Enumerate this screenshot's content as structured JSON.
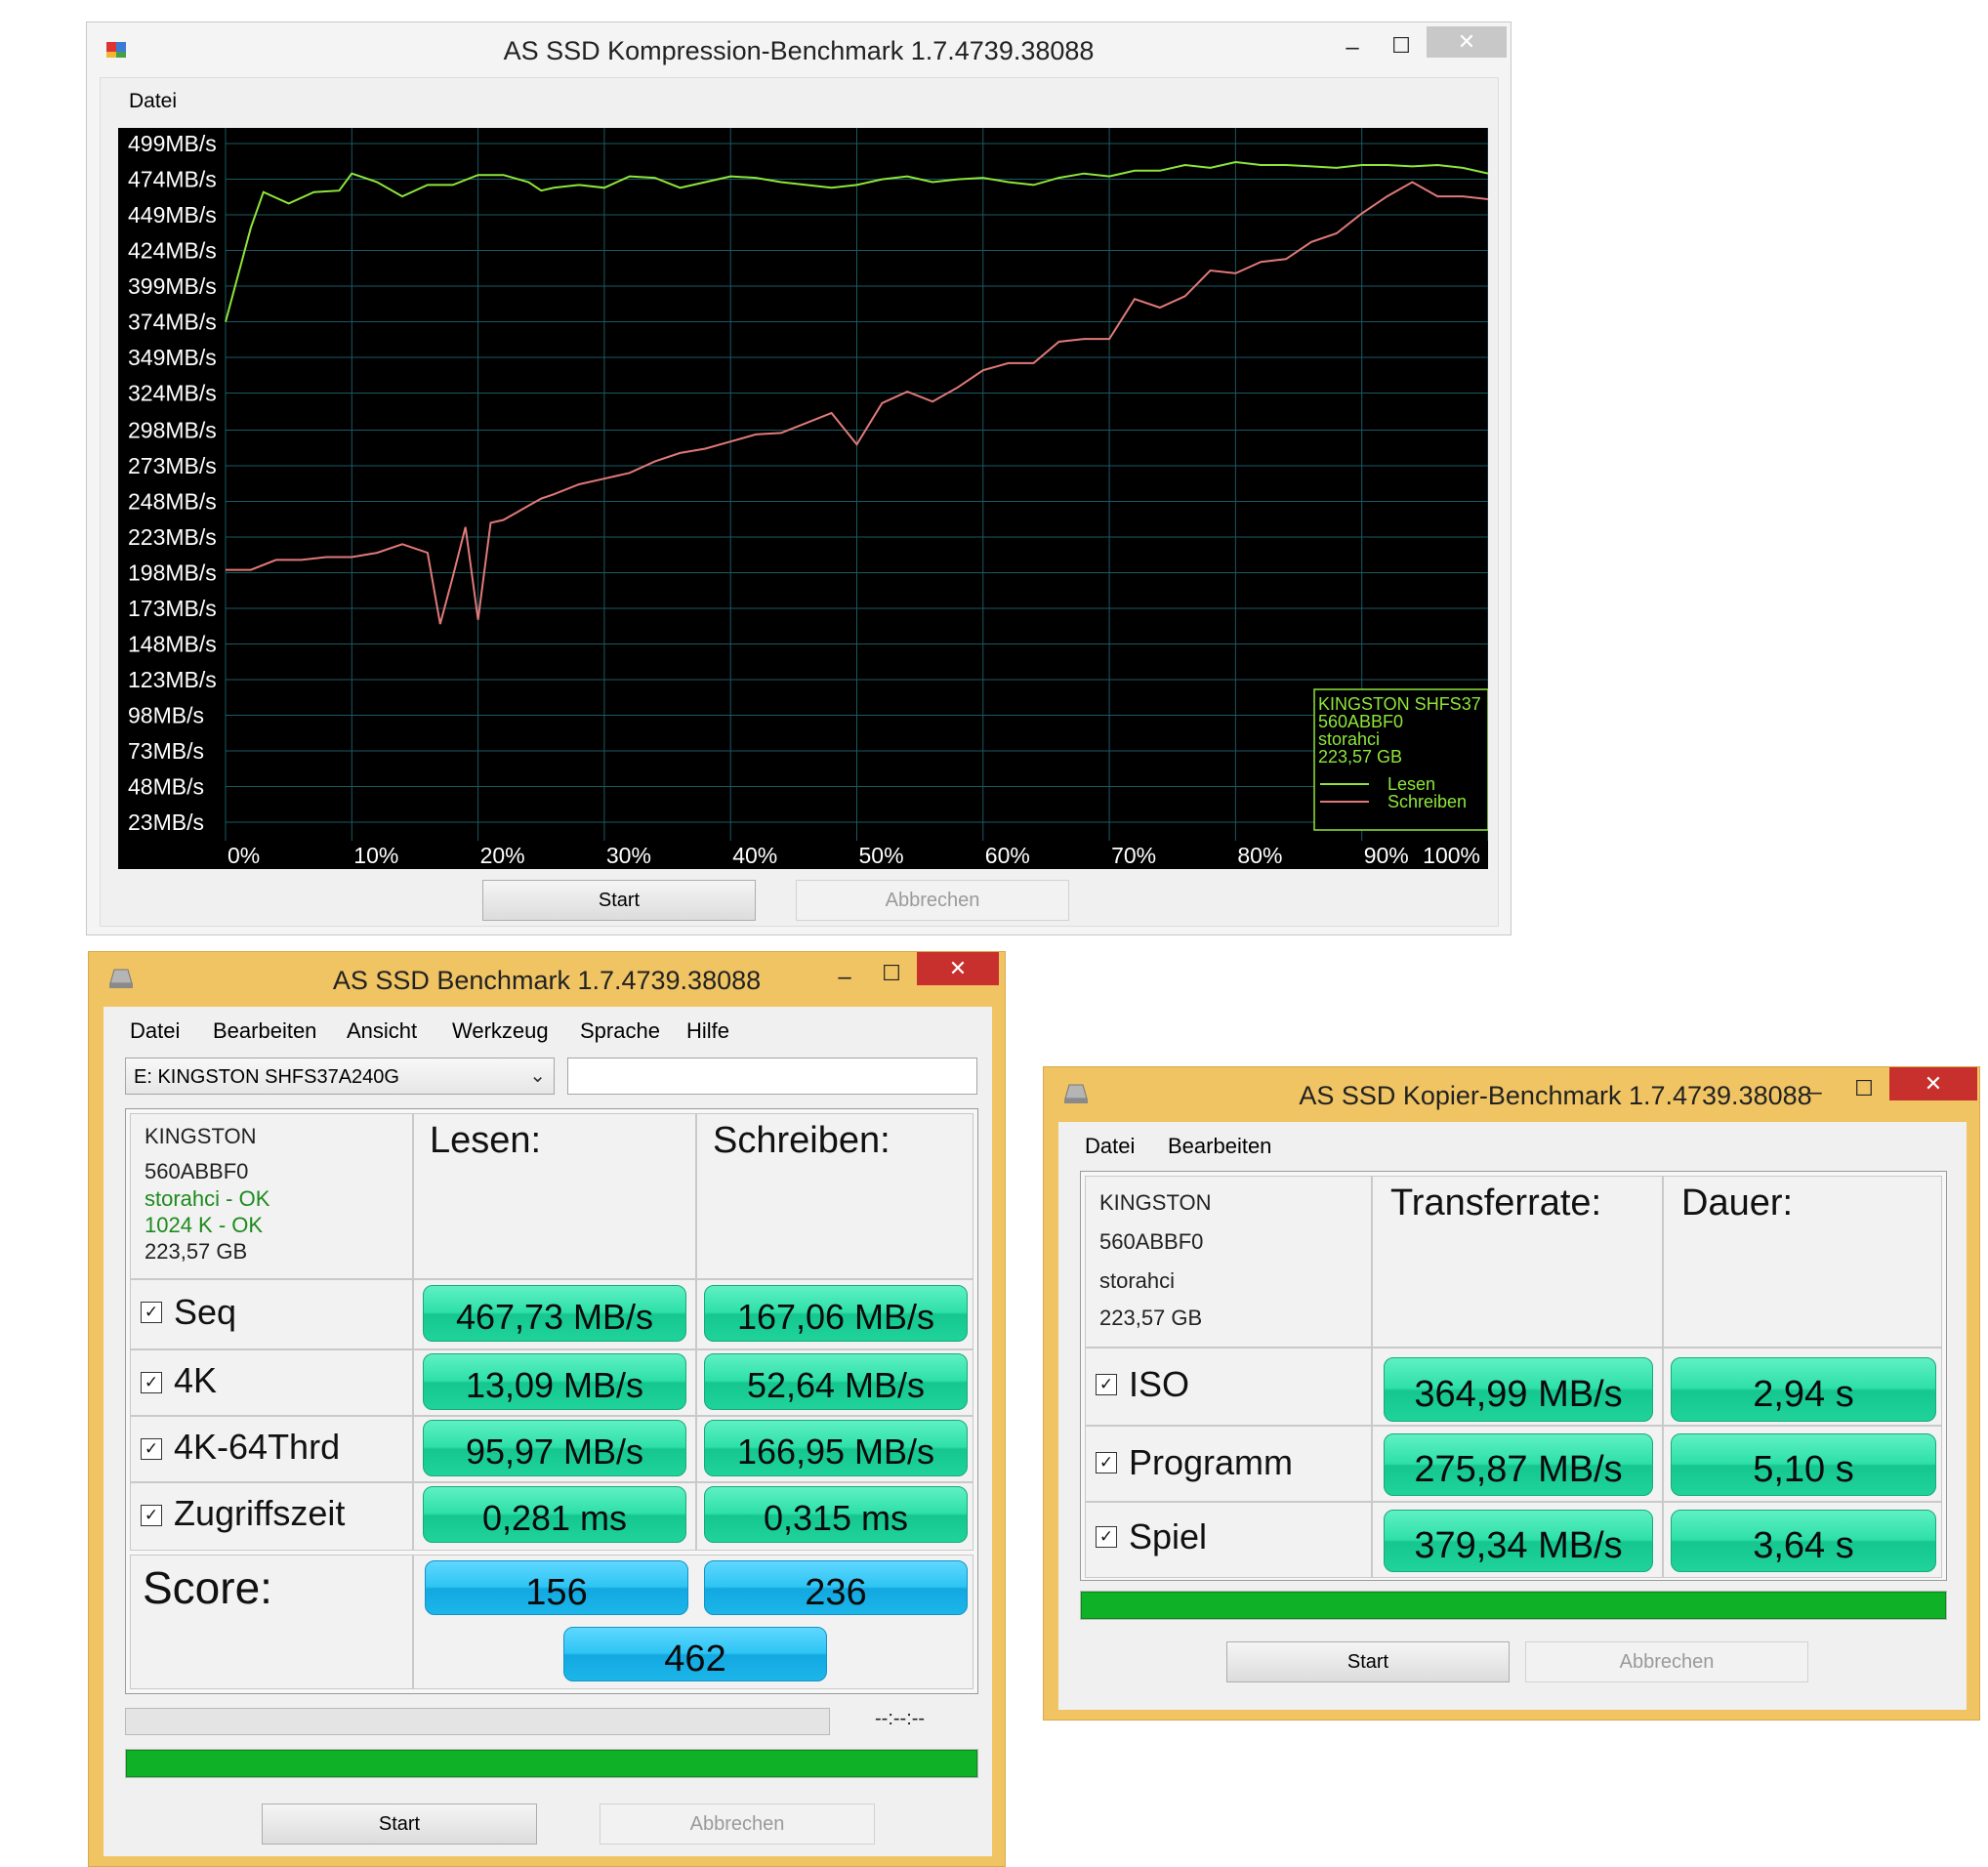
{
  "compression_window": {
    "title": "AS SSD Kompression-Benchmark 1.7.4739.38088",
    "minimize_glyph": "–",
    "maximize_glyph": "☐",
    "close_glyph": "✕",
    "menu": [
      "Datei"
    ],
    "start_label": "Start",
    "cancel_label": "Abbrechen",
    "legend": {
      "lines": [
        "KINGSTON SHFS37",
        "560ABBF0",
        "storahci",
        "223,57 GB"
      ],
      "read_label": "Lesen",
      "write_label": "Schreiben"
    },
    "colors": {
      "read": "#8ee63a",
      "write": "#e07a78",
      "grid": "#1a5a63",
      "text": "#ffffff",
      "background": "#000000"
    }
  },
  "chart_data": {
    "type": "line",
    "y_tick_labels": [
      "499MB/s",
      "474MB/s",
      "449MB/s",
      "424MB/s",
      "399MB/s",
      "374MB/s",
      "349MB/s",
      "324MB/s",
      "298MB/s",
      "273MB/s",
      "248MB/s",
      "223MB/s",
      "198MB/s",
      "173MB/s",
      "148MB/s",
      "123MB/s",
      "98MB/s",
      "73MB/s",
      "48MB/s",
      "23MB/s"
    ],
    "x_tick_labels": [
      "0%",
      "10%",
      "20%",
      "30%",
      "40%",
      "50%",
      "60%",
      "70%",
      "80%",
      "90%",
      "100%"
    ],
    "xlim": [
      0,
      100
    ],
    "ylim": [
      10,
      510
    ],
    "grid": true,
    "legend_position": "bottom-right",
    "series": [
      {
        "name": "Lesen",
        "x": [
          0,
          2,
          3,
          5,
          7,
          9,
          10,
          12,
          14,
          16,
          18,
          20,
          22,
          24,
          25,
          26,
          28,
          30,
          32,
          34,
          36,
          38,
          40,
          42,
          44,
          46,
          48,
          50,
          52,
          54,
          56,
          58,
          60,
          62,
          64,
          66,
          68,
          70,
          72,
          74,
          76,
          78,
          80,
          82,
          84,
          86,
          88,
          90,
          92,
          94,
          96,
          98,
          100
        ],
        "y": [
          374,
          440,
          465,
          457,
          465,
          466,
          478,
          472,
          462,
          470,
          470,
          477,
          477,
          472,
          466,
          468,
          470,
          468,
          476,
          475,
          468,
          472,
          476,
          475,
          472,
          470,
          468,
          470,
          474,
          476,
          472,
          474,
          475,
          472,
          470,
          475,
          478,
          476,
          480,
          480,
          484,
          482,
          486,
          484,
          484,
          483,
          482,
          484,
          484,
          483,
          484,
          482,
          478
        ]
      },
      {
        "name": "Schreiben",
        "x": [
          0,
          2,
          4,
          6,
          8,
          10,
          12,
          14,
          16,
          17,
          18,
          19,
          20,
          21,
          22,
          23,
          24,
          25,
          26,
          28,
          30,
          32,
          34,
          36,
          38,
          40,
          42,
          44,
          46,
          48,
          50,
          52,
          54,
          56,
          58,
          60,
          62,
          64,
          66,
          68,
          70,
          72,
          74,
          76,
          78,
          80,
          82,
          84,
          86,
          88,
          90,
          92,
          94,
          96,
          98,
          100
        ],
        "y": [
          200,
          200,
          207,
          207,
          209,
          209,
          212,
          218,
          212,
          162,
          195,
          230,
          165,
          233,
          235,
          240,
          245,
          250,
          253,
          260,
          264,
          268,
          276,
          282,
          285,
          290,
          295,
          296,
          303,
          310,
          288,
          317,
          325,
          318,
          328,
          340,
          345,
          345,
          360,
          362,
          362,
          390,
          384,
          392,
          410,
          408,
          416,
          418,
          430,
          436,
          450,
          462,
          472,
          462,
          462,
          460
        ]
      }
    ]
  },
  "benchmark_window": {
    "title": "AS SSD Benchmark 1.7.4739.38088",
    "minimize_glyph": "–",
    "maximize_glyph": "☐",
    "close_glyph": "✕",
    "menu": [
      "Datei",
      "Bearbeiten",
      "Ansicht",
      "Werkzeug",
      "Sprache",
      "Hilfe"
    ],
    "drive_select": "E: KINGSTON SHFS37A240G",
    "drive_info": [
      "KINGSTON",
      "560ABBF0",
      "storahci - OK",
      "1024 K - OK",
      "223,57 GB"
    ],
    "col_read": "Lesen:",
    "col_write": "Schreiben:",
    "check_glyph": "✓",
    "rows": [
      {
        "label": "Seq",
        "read": "467,73 MB/s",
        "write": "167,06 MB/s"
      },
      {
        "label": "4K",
        "read": "13,09 MB/s",
        "write": "52,64 MB/s"
      },
      {
        "label": "4K-64Thrd",
        "read": "95,97 MB/s",
        "write": "166,95 MB/s"
      },
      {
        "label": "Zugriffszeit",
        "read": "0,281 ms",
        "write": "0,315 ms"
      }
    ],
    "score_label": "Score:",
    "score_read": "156",
    "score_write": "236",
    "score_total": "462",
    "time_text": "--:--:--",
    "progress": 1.0,
    "start_label": "Start",
    "cancel_label": "Abbrechen"
  },
  "copy_window": {
    "title": "AS SSD Kopier-Benchmark 1.7.4739.38088",
    "minimize_glyph": "–",
    "maximize_glyph": "☐",
    "close_glyph": "✕",
    "menu": [
      "Datei",
      "Bearbeiten"
    ],
    "drive_info": [
      "KINGSTON",
      "560ABBF0",
      "storahci",
      "223,57 GB"
    ],
    "col_rate": "Transferrate:",
    "col_duration": "Dauer:",
    "check_glyph": "✓",
    "rows": [
      {
        "label": "ISO",
        "rate": "364,99 MB/s",
        "duration": "2,94 s"
      },
      {
        "label": "Programm",
        "rate": "275,87 MB/s",
        "duration": "5,10 s"
      },
      {
        "label": "Spiel",
        "rate": "379,34 MB/s",
        "duration": "3,64 s"
      }
    ],
    "progress": 1.0,
    "start_label": "Start",
    "cancel_label": "Abbrechen"
  }
}
